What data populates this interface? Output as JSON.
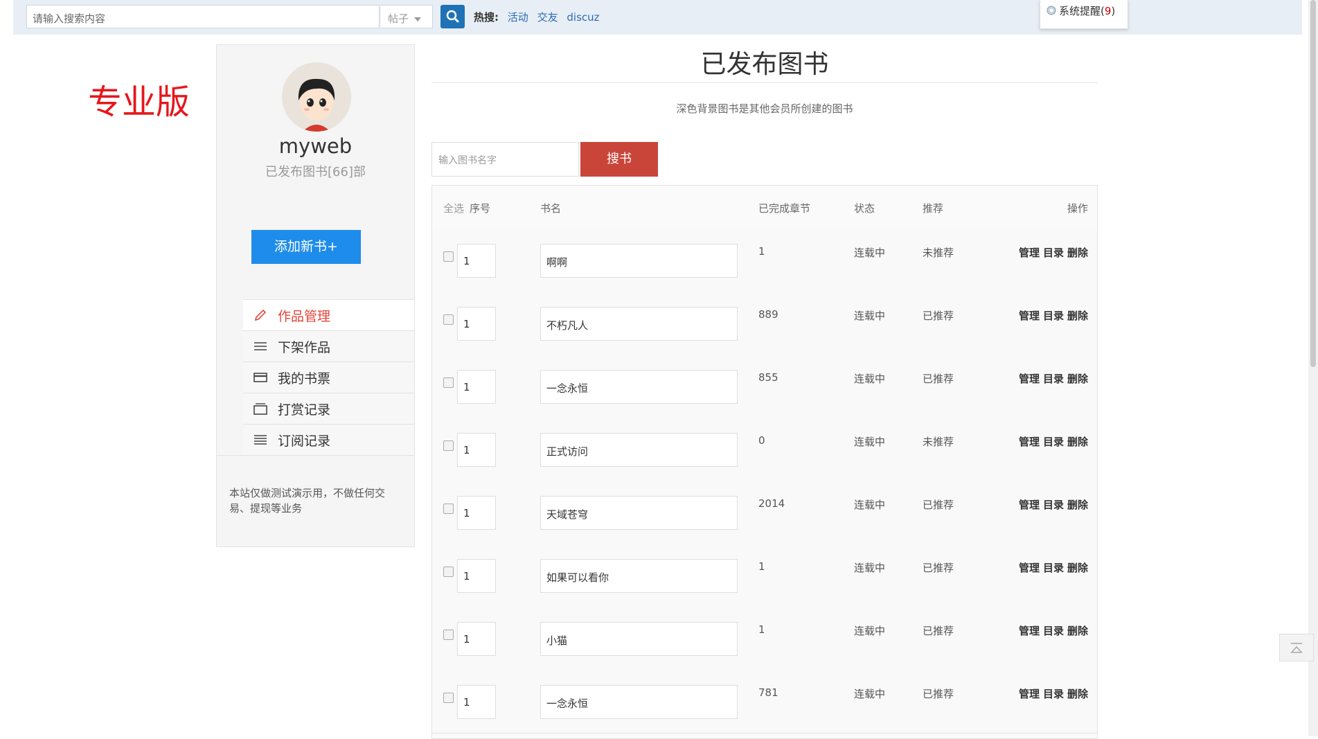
{
  "topbar": {
    "search_placeholder": "请输入搜索内容",
    "search_type": "帖子",
    "hot_label": "热搜:",
    "hot_links": [
      "活动",
      "交友",
      "discuz"
    ],
    "notice_label": "系统提醒(",
    "notice_count": "9",
    "notice_close": ")"
  },
  "version_label": "专业版",
  "sidebar": {
    "username": "myweb",
    "published_count": "已发布图书[66]部",
    "add_button": "添加新书+",
    "menu": [
      {
        "label": "作品管理",
        "icon": "pencil-icon",
        "active": true
      },
      {
        "label": "下架作品",
        "icon": "list-icon"
      },
      {
        "label": "我的书票",
        "icon": "card-icon"
      },
      {
        "label": "打赏记录",
        "icon": "box-icon"
      },
      {
        "label": "订阅记录",
        "icon": "lines-icon"
      }
    ],
    "note": "本站仅做测试演示用，不做任何交易、提现等业务"
  },
  "main": {
    "title": "已发布图书",
    "subtitle": "深色背景图书是其他会员所创建的图书",
    "book_search_placeholder": "输入图书名字",
    "book_search_button": "搜书",
    "columns": {
      "select_all": "全选",
      "seq": "序号",
      "name": "书名",
      "chapters": "已完成章节",
      "status": "状态",
      "recommend": "推荐",
      "ops": "操作"
    },
    "rows": [
      {
        "seq": "1",
        "name": "啊啊",
        "chapters": "1",
        "status": "连载中",
        "recommend": "未推荐"
      },
      {
        "seq": "1",
        "name": "不朽凡人",
        "chapters": "889",
        "status": "连载中",
        "recommend": "已推荐"
      },
      {
        "seq": "1",
        "name": "一念永恒",
        "chapters": "855",
        "status": "连载中",
        "recommend": "已推荐"
      },
      {
        "seq": "1",
        "name": "正式访问",
        "chapters": "0",
        "status": "连载中",
        "recommend": "未推荐"
      },
      {
        "seq": "1",
        "name": "天域苍穹",
        "chapters": "2014",
        "status": "连载中",
        "recommend": "已推荐"
      },
      {
        "seq": "1",
        "name": "如果可以看你",
        "chapters": "1",
        "status": "连载中",
        "recommend": "已推荐"
      },
      {
        "seq": "1",
        "name": "小猫",
        "chapters": "1",
        "status": "连载中",
        "recommend": "已推荐"
      },
      {
        "seq": "1",
        "name": "一念永恒",
        "chapters": "781",
        "status": "连载中",
        "recommend": "已推荐"
      }
    ],
    "ops_labels": {
      "manage": "管理",
      "toc": "目录",
      "delete": "删除"
    }
  },
  "colors": {
    "accent_blue": "#1e8cea",
    "accent_red": "#c9453a",
    "version_red": "#e5171c"
  }
}
